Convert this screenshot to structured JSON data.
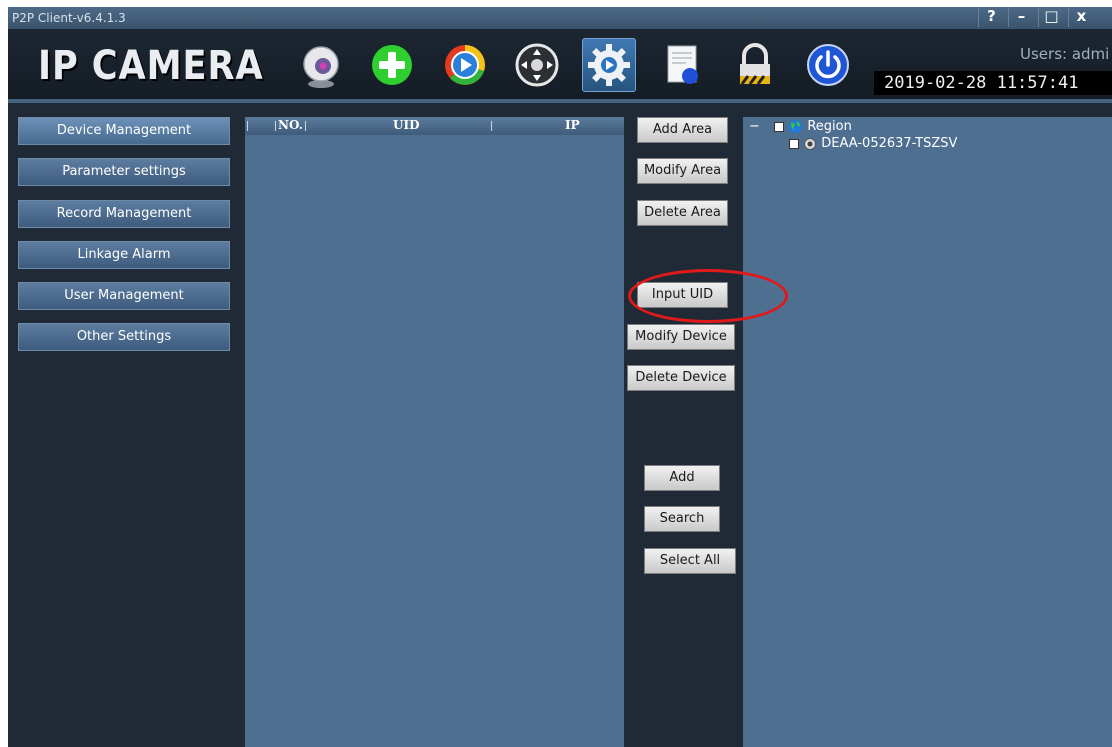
{
  "window": {
    "title": "P2P Client-v6.4.1.3",
    "help": "?",
    "minimize": "–",
    "maximize": "□",
    "close": "x"
  },
  "header": {
    "logo": "IP CAMERA",
    "users": "Users: admi",
    "datetime": "2019-02-28 11:57:41",
    "toolbar": [
      {
        "icon": "webcam-icon"
      },
      {
        "icon": "add-icon"
      },
      {
        "icon": "playback-icon"
      },
      {
        "icon": "ptz-icon"
      },
      {
        "icon": "settings-icon",
        "active": true
      },
      {
        "icon": "log-icon"
      },
      {
        "icon": "lock-icon"
      },
      {
        "icon": "power-icon"
      }
    ]
  },
  "nav": {
    "device_management": "Device Management",
    "parameter_settings": "Parameter settings",
    "record_management": "Record Management",
    "linkage_alarm": "Linkage Alarm",
    "user_management": "User Management",
    "other_settings": "Other Settings"
  },
  "device_list": {
    "columns": {
      "no": "NO.",
      "uid": "UID",
      "ip": "IP"
    }
  },
  "actions": {
    "add_area": "Add Area",
    "modify_area": "Modify Area",
    "delete_area": "Delete Area",
    "input_uid": "Input UID",
    "modify_device": "Modify Device",
    "delete_device": "Delete Device",
    "add": "Add",
    "search": "Search",
    "select_all": "Select All"
  },
  "tree": {
    "collapse_symbol": "−",
    "root_label": "Region",
    "device_label": "DEAA-052637-TSZSV"
  },
  "colors": {
    "highlight": "#e01a1a",
    "panel": "#4f6f91",
    "background": "#1f2a36"
  }
}
